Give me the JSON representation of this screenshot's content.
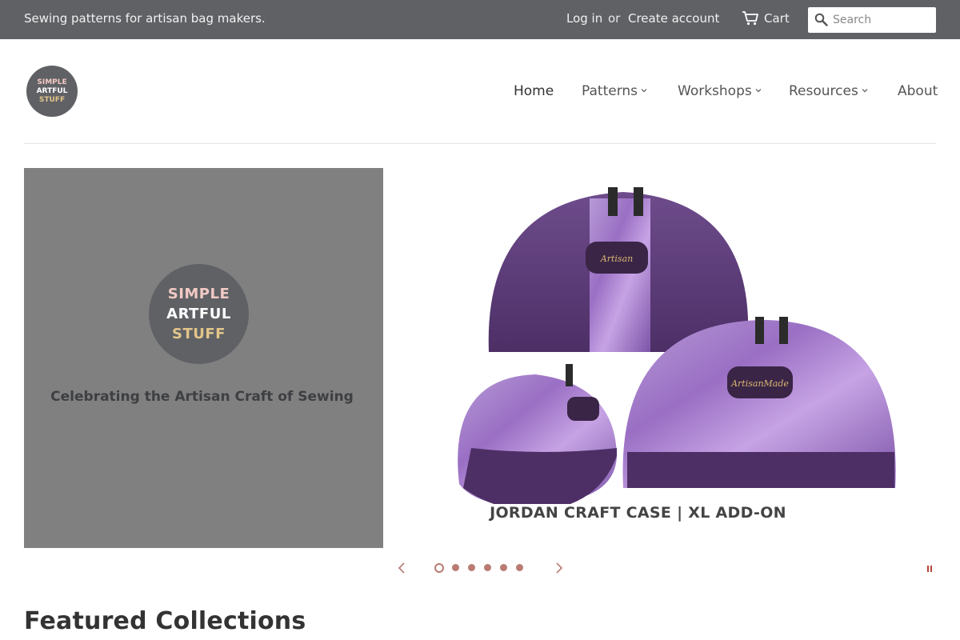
{
  "topbar": {
    "tagline": "Sewing patterns for artisan bag makers.",
    "login": "Log in",
    "or": "or",
    "create_account": "Create account",
    "cart": "Cart",
    "search_placeholder": "Search"
  },
  "logo": {
    "line1": "SIMPLE",
    "line2": "ARTFUL",
    "line3": "STUFF"
  },
  "nav": {
    "items": [
      {
        "label": "Home",
        "has_dropdown": false,
        "active": true
      },
      {
        "label": "Patterns",
        "has_dropdown": true
      },
      {
        "label": "Workshops",
        "has_dropdown": true
      },
      {
        "label": "Resources",
        "has_dropdown": true
      },
      {
        "label": "About",
        "has_dropdown": false
      }
    ]
  },
  "slideshow": {
    "left_caption": "Celebrating the Artisan Craft of Sewing",
    "product_title": "JORDAN CRAFT CASE | XL ADD-ON",
    "bag_label": "Artisan Made",
    "slide_count": 6,
    "active_slide": 1
  },
  "featured": {
    "title": "Featured Collections"
  },
  "colors": {
    "topbar_bg": "#5f6165",
    "accent": "#b87a73",
    "slide_gray": "#808080",
    "bag_purple": "#5b3a75"
  }
}
